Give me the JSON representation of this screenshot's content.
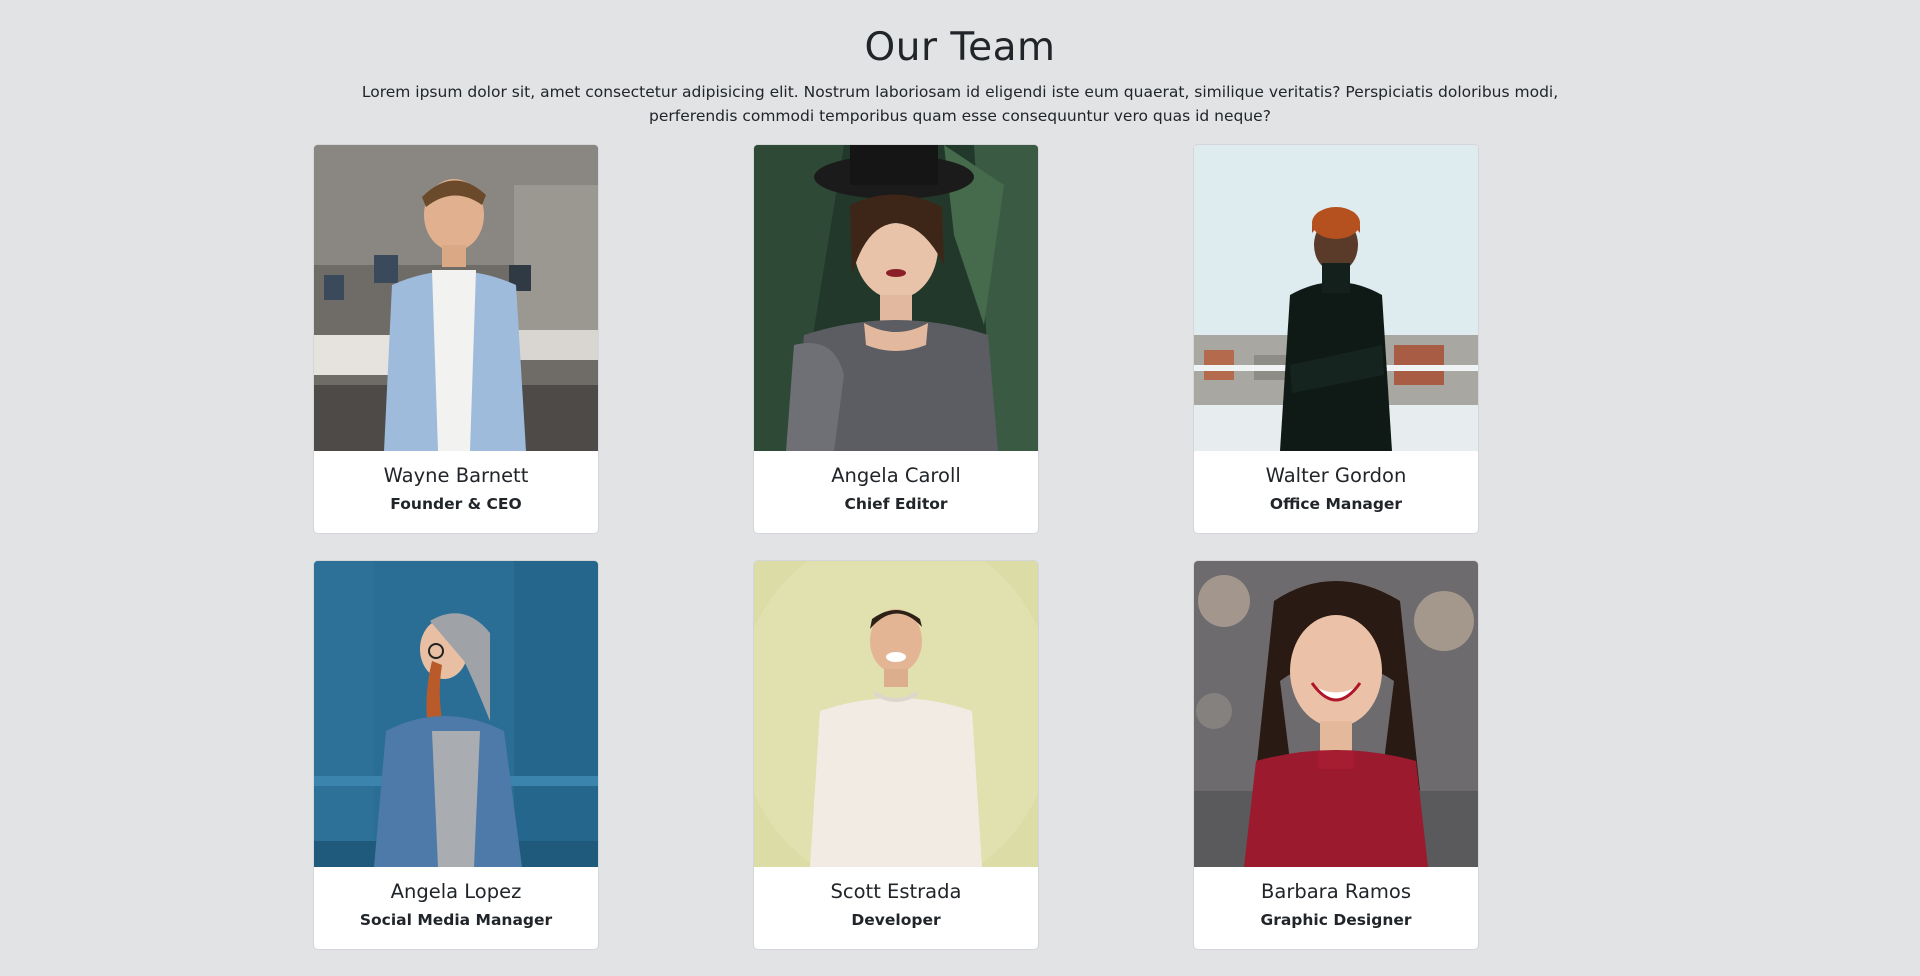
{
  "header": {
    "title": "Our Team",
    "intro": "Lorem ipsum dolor sit, amet consectetur adipisicing elit. Nostrum laboriosam id eligendi iste eum quaerat, similique veritatis? Perspiciatis doloribus modi, perferendis commodi temporibus quam esse consequuntur vero quas id neque?"
  },
  "team": [
    {
      "name": "Wayne Barnett",
      "role": "Founder & CEO"
    },
    {
      "name": "Angela Caroll",
      "role": "Chief Editor"
    },
    {
      "name": "Walter Gordon",
      "role": "Office Manager"
    },
    {
      "name": "Angela Lopez",
      "role": "Social Media Manager"
    },
    {
      "name": "Scott Estrada",
      "role": "Developer"
    },
    {
      "name": "Barbara Ramos",
      "role": "Graphic Designer"
    }
  ],
  "colors": {
    "page_background": "#e2e3e5",
    "card_background": "#ffffff",
    "text": "#212529"
  }
}
